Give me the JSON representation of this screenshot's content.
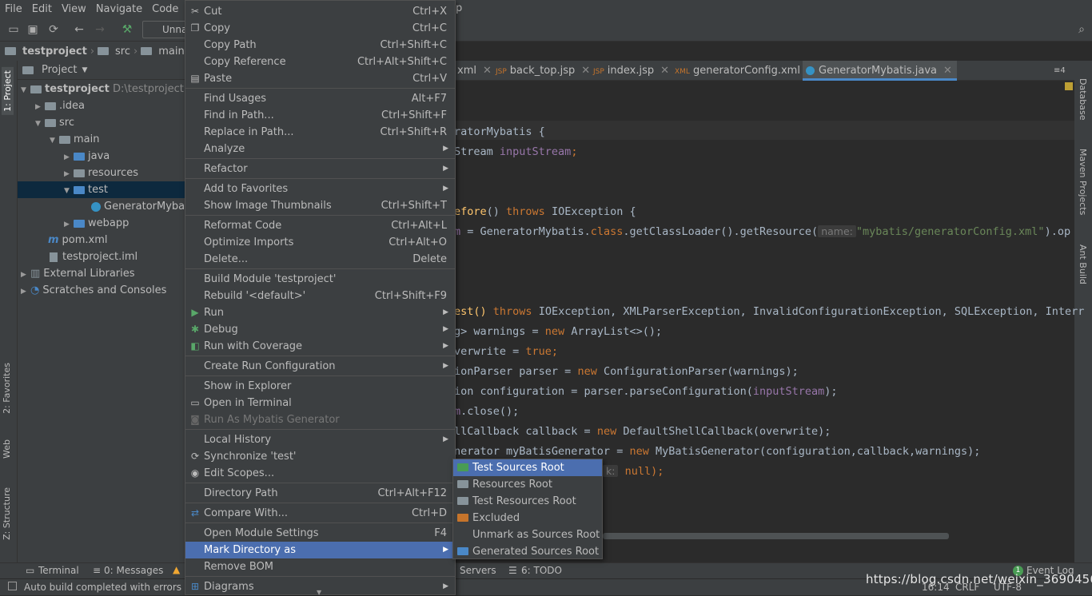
{
  "menubar": {
    "items": [
      "File",
      "Edit",
      "View",
      "Navigate",
      "Code",
      "Ar"
    ],
    "tail": "p"
  },
  "toolbar": {
    "run_config": "Unna"
  },
  "breadcrumb": {
    "items": [
      "testproject",
      "src",
      "main"
    ]
  },
  "project_panel": {
    "title": "Project",
    "tree": [
      {
        "label": "testproject",
        "extra": "D:\\testproject",
        "icon": "folder-icon"
      },
      {
        "label": ".idea",
        "icon": "folder-icon"
      },
      {
        "label": "src",
        "icon": "folder-icon"
      },
      {
        "label": "main",
        "icon": "folder-icon"
      },
      {
        "label": "java",
        "icon": "folder-icon"
      },
      {
        "label": "resources",
        "icon": "folder-icon"
      },
      {
        "label": "test",
        "icon": "folder-icon"
      },
      {
        "label": "GeneratorMybat",
        "icon": "java-class-icon"
      },
      {
        "label": "webapp",
        "icon": "folder-icon"
      },
      {
        "label": "pom.xml",
        "icon": "maven-icon"
      },
      {
        "label": "testproject.iml",
        "icon": "file-icon"
      },
      {
        "label": "External Libraries",
        "icon": "library-icon"
      },
      {
        "label": "Scratches and Consoles",
        "icon": "scratch-icon"
      }
    ]
  },
  "left_tabs": {
    "project": "1: Project",
    "favorites": "2: Favorites",
    "web": "Web",
    "structure": "Z: Structure"
  },
  "right_tabs": {
    "database": "Database",
    "maven": "Maven Projects",
    "ant": "Ant Build"
  },
  "editor_tabs": [
    {
      "label": "xml"
    },
    {
      "label": "back_top.jsp"
    },
    {
      "label": "index.jsp"
    },
    {
      "label": "generatorConfig.xml"
    },
    {
      "label": "GeneratorMybatis.java"
    }
  ],
  "tabs_overflow": "≡4",
  "code": {
    "l1": "ratorMybatis {",
    "l2a": "Stream ",
    "l2b": "inputStream",
    "l2c": ";",
    "l3a": "efore",
    "l3b": "() ",
    "l3c": "throws",
    "l3d": " IOException {",
    "l4a": "m",
    "l4b": " = GeneratorMybatis.",
    "l4c": "class",
    "l4d": ".getClassLoader().getResource(",
    "l4hint": "name:",
    "l4e": "\"mybatis/generatorConfig.xml\"",
    "l4f": ").op",
    "l5a": "est() ",
    "l5b": "throws",
    "l5c": " IOException, XMLParserException, InvalidConfigurationException, SQLException, Interr",
    "l6a": "g> warnings = ",
    "l6b": "new",
    "l6c": " ArrayList<>();",
    "l7a": "verwrite = ",
    "l7b": "true",
    "l7c": ";",
    "l8a": "ionParser parser = ",
    "l8b": "new",
    "l8c": " ConfigurationParser(warnings);",
    "l9a": "ion configuration = parser.parseConfiguration(",
    "l9b": "inputStream",
    "l9c": ");",
    "l10a": "m",
    "l10b": ".close();",
    "l11a": "llCallback callback = ",
    "l11b": "new",
    "l11c": " DefaultShellCallback(overwrite);",
    "l12a": "nerator myBatisGenerator = ",
    "l12b": "new",
    "l12c": " MyBatisGenerator(configuration,callback,warnings);",
    "l13a": "k:",
    "l13b": " null);"
  },
  "context_menu": {
    "items": [
      {
        "label": "Cut",
        "shortcut": "Ctrl+X",
        "icon": "scissors-icon"
      },
      {
        "label": "Copy",
        "shortcut": "Ctrl+C",
        "icon": "copy-icon"
      },
      {
        "label": "Copy Path",
        "shortcut": "Ctrl+Shift+C"
      },
      {
        "label": "Copy Reference",
        "shortcut": "Ctrl+Alt+Shift+C"
      },
      {
        "label": "Paste",
        "shortcut": "Ctrl+V",
        "icon": "paste-icon"
      },
      {
        "label": "Find Usages",
        "shortcut": "Alt+F7"
      },
      {
        "label": "Find in Path...",
        "shortcut": "Ctrl+Shift+F"
      },
      {
        "label": "Replace in Path...",
        "shortcut": "Ctrl+Shift+R"
      },
      {
        "label": "Analyze",
        "submenu": true
      },
      {
        "label": "Refactor",
        "submenu": true
      },
      {
        "label": "Add to Favorites",
        "submenu": true
      },
      {
        "label": "Show Image Thumbnails",
        "shortcut": "Ctrl+Shift+T"
      },
      {
        "label": "Reformat Code",
        "shortcut": "Ctrl+Alt+L"
      },
      {
        "label": "Optimize Imports",
        "shortcut": "Ctrl+Alt+O"
      },
      {
        "label": "Delete...",
        "shortcut": "Delete"
      },
      {
        "label": "Build Module 'testproject'"
      },
      {
        "label": "Rebuild '<default>'",
        "shortcut": "Ctrl+Shift+F9"
      },
      {
        "label": "Run",
        "submenu": true,
        "icon": "run-icon"
      },
      {
        "label": "Debug",
        "submenu": true,
        "icon": "debug-icon"
      },
      {
        "label": "Run with Coverage",
        "submenu": true,
        "icon": "coverage-icon"
      },
      {
        "label": "Create Run Configuration",
        "submenu": true
      },
      {
        "label": "Show in Explorer"
      },
      {
        "label": "Open in Terminal",
        "icon": "terminal-icon"
      },
      {
        "label": "Run As Mybatis Generator",
        "disabled": true,
        "icon": "mybatis-icon"
      },
      {
        "label": "Local History",
        "submenu": true
      },
      {
        "label": "Synchronize 'test'",
        "icon": "sync-icon"
      },
      {
        "label": "Edit Scopes...",
        "icon": "scope-icon"
      },
      {
        "label": "Directory Path",
        "shortcut": "Ctrl+Alt+F12"
      },
      {
        "label": "Compare With...",
        "shortcut": "Ctrl+D",
        "icon": "compare-icon"
      },
      {
        "label": "Open Module Settings",
        "shortcut": "F4"
      },
      {
        "label": "Mark Directory as",
        "submenu": true,
        "highlighted": true
      },
      {
        "label": "Remove BOM"
      },
      {
        "label": "Diagrams",
        "submenu": true,
        "icon": "diagram-icon"
      }
    ]
  },
  "mark_submenu": {
    "items": [
      {
        "label": "Test Sources Root",
        "color": "#499c54",
        "highlighted": true
      },
      {
        "label": "Resources Root",
        "color": "#87939a"
      },
      {
        "label": "Test Resources Root",
        "color": "#87939a"
      },
      {
        "label": "Excluded",
        "color": "#c6742b"
      },
      {
        "label": "Unmark as Sources Root"
      },
      {
        "label": "Generated Sources Root",
        "color": "#4a88c7"
      }
    ]
  },
  "bottom_tabs": {
    "terminal": "Terminal",
    "messages": "0: Messages",
    "servers": "Servers",
    "todo": "6: TODO",
    "event_log": "Event Log",
    "event_count": "1"
  },
  "status": {
    "message": "Auto build completed with errors",
    "position": "16:14",
    "line_sep": "CRLF",
    "encoding": "UTF-8"
  },
  "watermark": "https://blog.csdn.net/weixin_36904568",
  "colors": {
    "accent": "#4b6eaf",
    "background": "#2b2b2b",
    "panel": "#3c3f41",
    "keyword": "#cc7832",
    "string": "#6a8759",
    "field": "#9876aa"
  }
}
